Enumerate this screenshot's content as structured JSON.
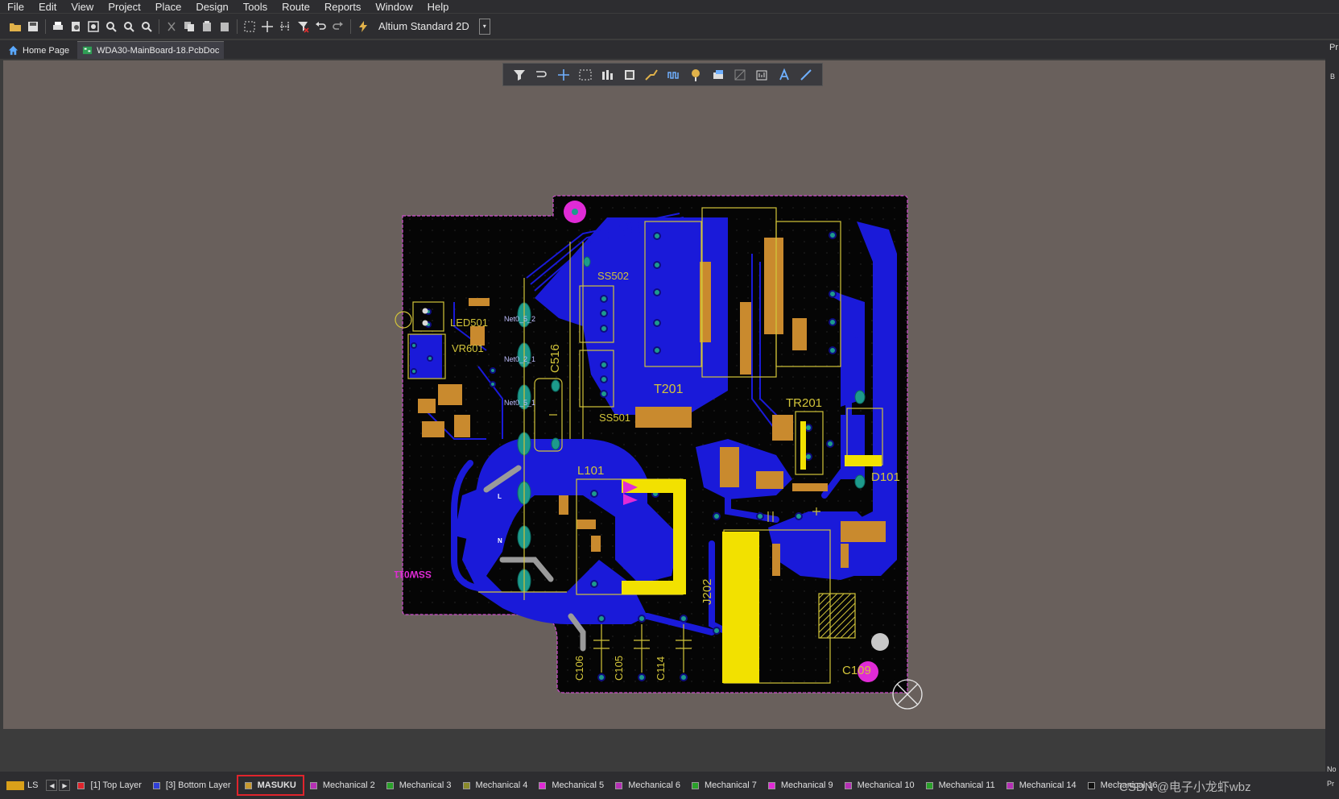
{
  "menu": [
    "File",
    "Edit",
    "View",
    "Project",
    "Place",
    "Design",
    "Tools",
    "Route",
    "Reports",
    "Window",
    "Help"
  ],
  "toolbar": {
    "view_mode": "Altium Standard 2D"
  },
  "tabs": [
    {
      "label": "Home Page",
      "icon": "home-icon",
      "active": false
    },
    {
      "label": "WDA30-MainBoard-18.PcbDoc",
      "icon": "pcb-doc-icon",
      "active": true
    }
  ],
  "pcb": {
    "designators": [
      "SS502",
      "LED501",
      "VR601",
      "C516",
      "T201",
      "TR201",
      "SS501",
      "L101",
      "D101",
      "J202",
      "C106",
      "C105",
      "C114",
      "C109"
    ],
    "nets": [
      "Net0_5_2",
      "Net0_2_1",
      "Net0_5_1"
    ],
    "silk_text": "SSW011",
    "pin_labels": [
      "L",
      "N"
    ]
  },
  "layers": {
    "ls_label": "LS",
    "items": [
      {
        "label": "[1] Top Layer",
        "color": "#e0242c",
        "selected": false
      },
      {
        "label": "[3] Bottom Layer",
        "color": "#2f3fd8",
        "selected": false
      },
      {
        "label": "MASUKU",
        "color": "#c99a2e",
        "selected": true
      },
      {
        "label": "Mechanical 2",
        "color": "#b52fb5",
        "selected": false
      },
      {
        "label": "Mechanical 3",
        "color": "#2aa12a",
        "selected": false
      },
      {
        "label": "Mechanical 4",
        "color": "#8a8a2a",
        "selected": false
      },
      {
        "label": "Mechanical 5",
        "color": "#e02bd6",
        "selected": false
      },
      {
        "label": "Mechanical 6",
        "color": "#b52fb5",
        "selected": false
      },
      {
        "label": "Mechanical 7",
        "color": "#2aa12a",
        "selected": false
      },
      {
        "label": "Mechanical 9",
        "color": "#e02bd6",
        "selected": false
      },
      {
        "label": "Mechanical 10",
        "color": "#b52fb5",
        "selected": false
      },
      {
        "label": "Mechanical 11",
        "color": "#2aa12a",
        "selected": false
      },
      {
        "label": "Mechanical 14",
        "color": "#b52fb5",
        "selected": false
      },
      {
        "label": "Mechanical 16",
        "color": "#111111",
        "selected": false
      }
    ]
  },
  "watermark": "CSDN @电子小龙虾wbz",
  "right_panel": {
    "label": "Pr",
    "sub": "B",
    "bot1": "No",
    "bot2": "Pr"
  }
}
